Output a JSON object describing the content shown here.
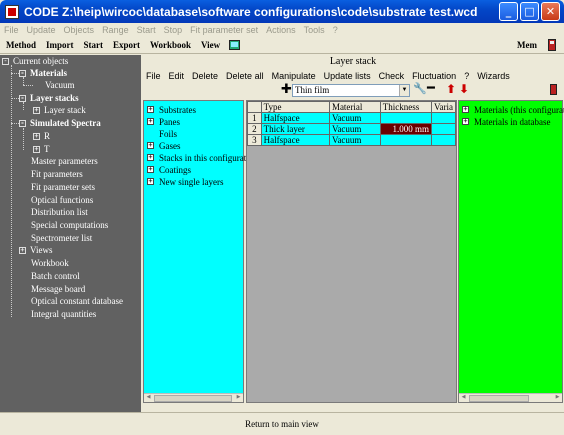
{
  "window": {
    "title": "CODE Z:\\heip\\wircoc\\database\\software configurations\\code\\substrate test.wcd",
    "minimize": "_",
    "maximize": "□",
    "close": "✕"
  },
  "main_menu": [
    "File",
    "Update",
    "Objects",
    "Range",
    "Start",
    "Stop",
    "Fit parameter set",
    "Actions",
    "Tools",
    "?"
  ],
  "toolbar": {
    "items": [
      "Method",
      "Import",
      "Start",
      "Export",
      "Workbook",
      "View"
    ],
    "mem_label": "Mem"
  },
  "tree": {
    "root": "Current objects",
    "materials": "Materials",
    "vacuum": "Vacuum",
    "layer_stacks": "Layer stacks",
    "layer_stack": "Layer stack",
    "simulated_spectra": "Simulated Spectra",
    "r": "R",
    "t": "T",
    "items": [
      "Master parameters",
      "Fit parameters",
      "Fit parameter sets",
      "Optical functions",
      "Distribution list",
      "Special computations",
      "Spectrometer list"
    ],
    "views": "Views",
    "items2": [
      "Workbook",
      "Batch control",
      "Message board",
      "Optical constant database",
      "Integral quantities"
    ]
  },
  "panel": {
    "title": "Layer stack",
    "menu": [
      "File",
      "Edit",
      "Delete",
      "Delete all",
      "Manipulate",
      "Update lists",
      "Check",
      "Fluctuation",
      "?",
      "Wizards"
    ],
    "combo_value": "Thin film",
    "plus_glyph": "✚",
    "minus_glyph": "━",
    "up_glyph": "⬆",
    "down_glyph": "⬇",
    "wrench_glyph": "🔧"
  },
  "left_list": [
    {
      "label": "Substrates",
      "expandable": true
    },
    {
      "label": "Panes",
      "expandable": true
    },
    {
      "label": "Foils",
      "expandable": false
    },
    {
      "label": "Gases",
      "expandable": true
    },
    {
      "label": "Stacks in this configuration",
      "expandable": true
    },
    {
      "label": "Coatings",
      "expandable": true
    },
    {
      "label": "New single layers",
      "expandable": true
    }
  ],
  "table": {
    "columns": [
      "",
      "Type",
      "Material",
      "Thickness",
      "Varia"
    ],
    "rows": [
      {
        "num": "1",
        "type": "Halfspace",
        "material": "Vacuum",
        "thickness": ""
      },
      {
        "num": "2",
        "type": "Thick layer",
        "material": "Vacuum",
        "thickness": "1.000 mm"
      },
      {
        "num": "3",
        "type": "Halfspace",
        "material": "Vacuum",
        "thickness": ""
      }
    ]
  },
  "right_list": [
    "Materials (this configuration)",
    "Materials in database"
  ],
  "bottom": {
    "return_label": "Return to main view"
  },
  "colors": {
    "cyan": "#00ffff",
    "green": "#00ff00",
    "tree_bg": "#616161",
    "selected_cell": "#6b0000"
  }
}
